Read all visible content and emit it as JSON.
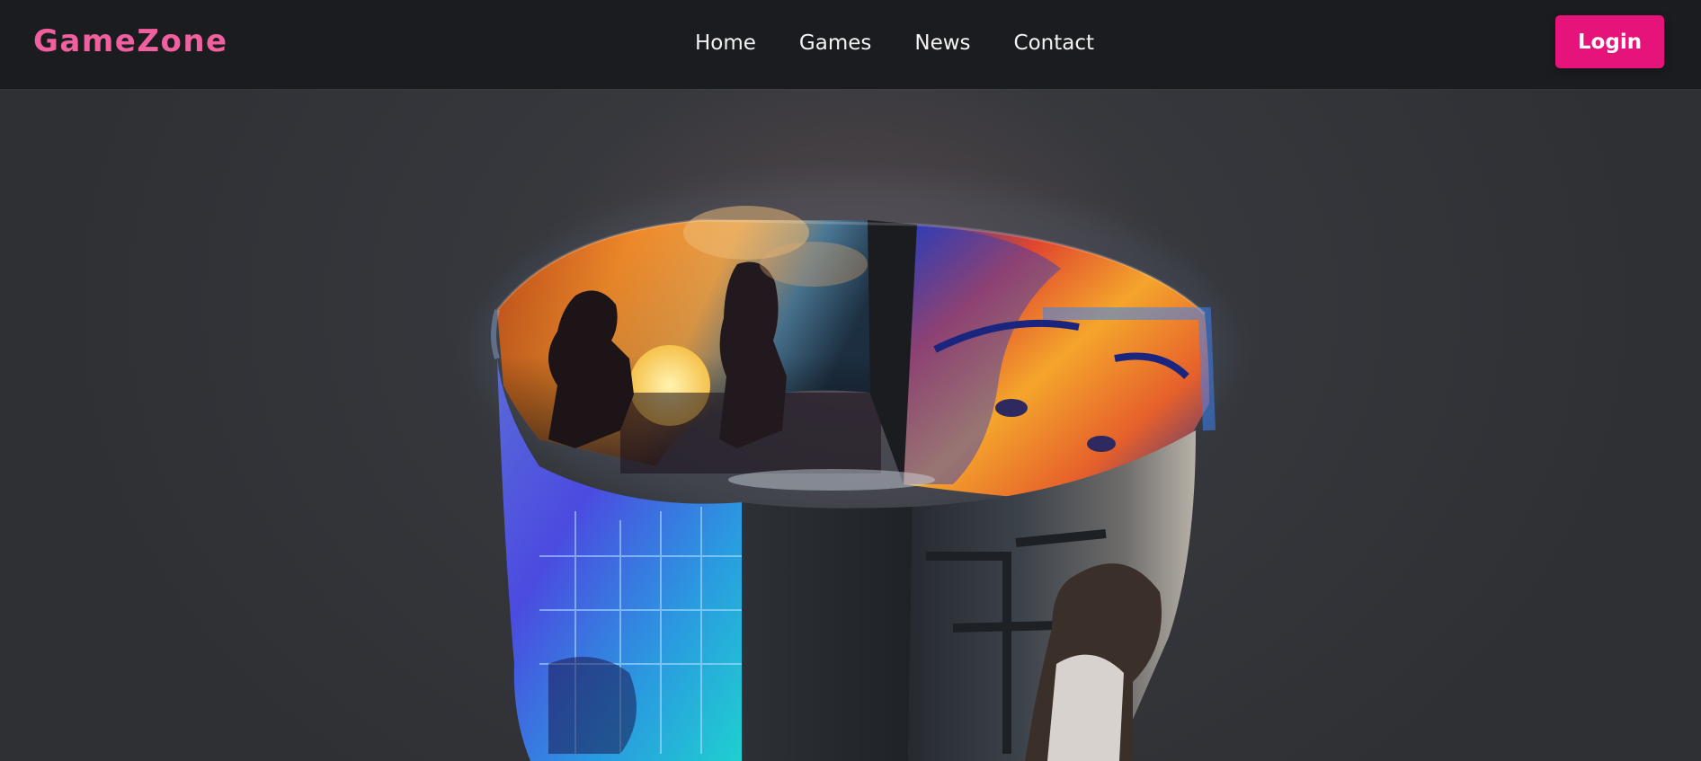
{
  "brand": {
    "name": "GameZone",
    "color": "#f0609e"
  },
  "nav": {
    "links": [
      {
        "label": "Home"
      },
      {
        "label": "Games"
      },
      {
        "label": "News"
      },
      {
        "label": "Contact"
      }
    ]
  },
  "login": {
    "label": "Login",
    "color": "#e5137a"
  },
  "hero": {
    "carousel_panels": [
      {
        "icon": "sunset-silhouettes-artwork"
      },
      {
        "icon": "neon-face-portrait-artwork"
      },
      {
        "icon": "girl-by-window-artwork"
      },
      {
        "icon": "cyber-city-artwork"
      }
    ]
  }
}
